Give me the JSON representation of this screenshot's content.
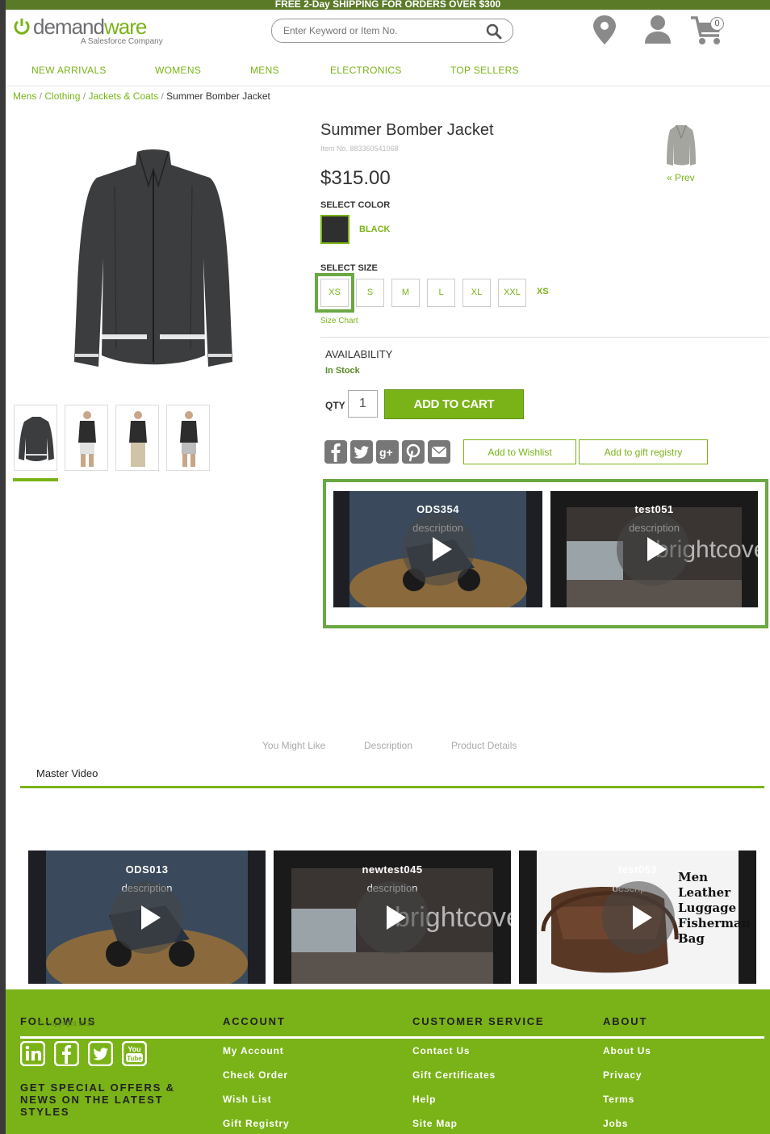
{
  "promo": "FREE 2-Day SHIPPING FOR ORDERS OVER $300",
  "logo": {
    "word_a": "demand",
    "word_b": "ware",
    "tagline": "A Salesforce Company"
  },
  "search": {
    "placeholder": "Enter Keyword or Item No."
  },
  "header": {
    "cart_count": "0"
  },
  "nav": [
    "NEW ARRIVALS",
    "WOMENS",
    "MENS",
    "ELECTRONICS",
    "TOP SELLERS"
  ],
  "breadcrumb": {
    "items": [
      "Mens",
      "Clothing",
      "Jackets & Coats"
    ],
    "current": "Summer Bomber Jacket",
    "separator": "/"
  },
  "product": {
    "title": "Summer Bomber Jacket",
    "item_no": "Item No. 883360541068",
    "price": "$315.00",
    "select_color_label": "SELECT COLOR",
    "color_name": "BLACK",
    "select_size_label": "SELECT SIZE",
    "sizes": [
      "XS",
      "S",
      "M",
      "L",
      "XL",
      "XXL"
    ],
    "selected_size": "XS",
    "size_chart": "Size Chart",
    "availability_label": "AVAILABILITY",
    "stock": "In Stock",
    "qty_label": "QTY",
    "qty": "1",
    "add_to_cart": "ADD TO CART",
    "wishlist": "Add to Wishlist",
    "gift_registry": "Add to gift registry",
    "prev": "« Prev"
  },
  "share_icons": [
    "facebook-icon",
    "twitter-icon",
    "google-plus-icon",
    "pinterest-icon",
    "email-icon"
  ],
  "product_videos": [
    {
      "title": "ODS354",
      "desc": "description"
    },
    {
      "title": "test051",
      "desc": "description"
    }
  ],
  "tabs": [
    "You Might Like",
    "Description",
    "Product Details"
  ],
  "master_video": {
    "title": "Master Video",
    "videos": [
      {
        "title": "ODS013",
        "desc": "description"
      },
      {
        "title": "newtest045",
        "desc": "description"
      },
      {
        "title": "test053",
        "desc": "description",
        "overlay": [
          "Men",
          "Leather",
          "Luggage",
          "Fisherman",
          "Bag"
        ]
      }
    ]
  },
  "video_brand": "brightcove",
  "footer": {
    "follow_us": "FOLLOW US",
    "copyright": "© Copyright 2015",
    "social": [
      "linkedin-icon",
      "facebook-icon",
      "twitter-icon",
      "youtube-icon"
    ],
    "offers": "GET SPECIAL OFFERS & NEWS ON THE LATEST STYLES",
    "account": {
      "heading": "ACCOUNT",
      "links": [
        "My Account",
        "Check Order",
        "Wish List",
        "Gift Registry"
      ]
    },
    "customer_service": {
      "heading": "CUSTOMER SERVICE",
      "links": [
        "Contact Us",
        "Gift Certificates",
        "Help",
        "Site Map"
      ]
    },
    "about": {
      "heading": "ABOUT",
      "links": [
        "About Us",
        "Privacy",
        "Terms",
        "Jobs"
      ]
    }
  },
  "colors": {
    "accent": "#7ab317",
    "footer_bg": "#7ab317",
    "promo_bg": "#5a7a28",
    "selection_border": "#6aa843"
  }
}
